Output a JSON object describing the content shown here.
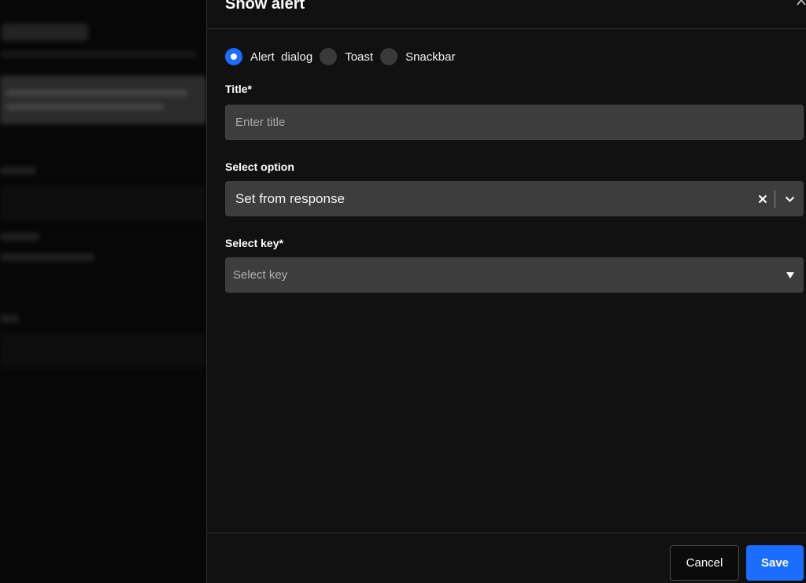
{
  "drawer": {
    "title": "Show alert"
  },
  "alert_type": {
    "options": [
      {
        "label": "Alert  dialog",
        "selected": true
      },
      {
        "label": "Toast",
        "selected": false
      },
      {
        "label": "Snackbar",
        "selected": false
      }
    ]
  },
  "title_field": {
    "label": "Title*",
    "placeholder": "Enter title",
    "value": ""
  },
  "select_option": {
    "label": "Select option",
    "value": "Set from response"
  },
  "select_key": {
    "label": "Select key*",
    "placeholder": "Select key"
  },
  "footer": {
    "cancel_label": "Cancel",
    "save_label": "Save"
  },
  "colors": {
    "accent": "#1a6dff",
    "panel_bg": "#111111",
    "field_bg": "#3d3d3d"
  },
  "icons": {
    "close": "close-icon",
    "clear": "clear-icon",
    "chevron": "chevron-down-icon",
    "caret": "caret-down-icon"
  }
}
